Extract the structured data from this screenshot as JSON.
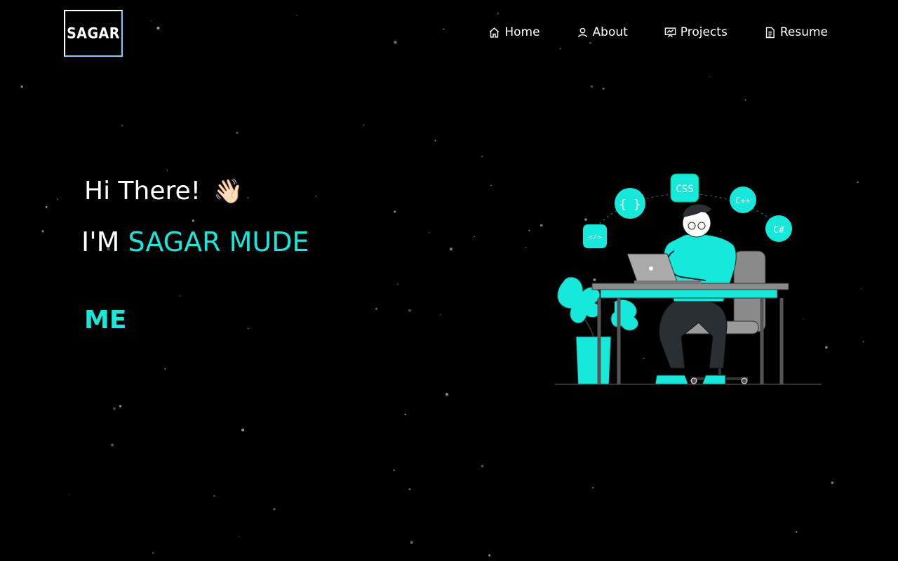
{
  "logo": {
    "text": "SAGAR"
  },
  "nav": [
    {
      "label": "Home",
      "icon": "home-icon"
    },
    {
      "label": "About",
      "icon": "user-icon"
    },
    {
      "label": "Projects",
      "icon": "presentation-icon"
    },
    {
      "label": "Resume",
      "icon": "document-icon"
    }
  ],
  "hero": {
    "greeting": "Hi There!",
    "wave": "👋🏻",
    "intro_prefix": "I'M ",
    "name": "SAGAR MUDE",
    "typed_text": "ME"
  },
  "illustration": {
    "badges": [
      "CSS",
      "{ }",
      "C++",
      "</>",
      "C#"
    ]
  },
  "colors": {
    "accent": "#14e9dc",
    "background": "#000000"
  }
}
